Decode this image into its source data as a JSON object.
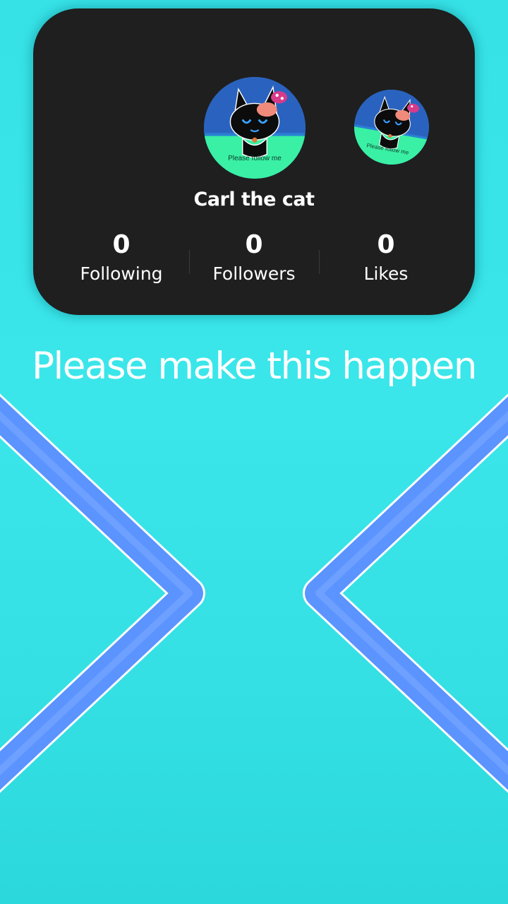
{
  "profile": {
    "username": "Carl the cat",
    "avatar_caption": "Please follow me",
    "stats": [
      {
        "count": "0",
        "label": "Following"
      },
      {
        "count": "0",
        "label": "Followers"
      },
      {
        "count": "0",
        "label": "Likes"
      }
    ]
  },
  "caption": "Please make this happen",
  "colors": {
    "background": "#38e4e8",
    "card": "#1f1f1f",
    "chevron": "#5b93ff",
    "text": "#ffffff"
  },
  "icons": [
    "left-chevron-icon",
    "right-chevron-icon"
  ]
}
